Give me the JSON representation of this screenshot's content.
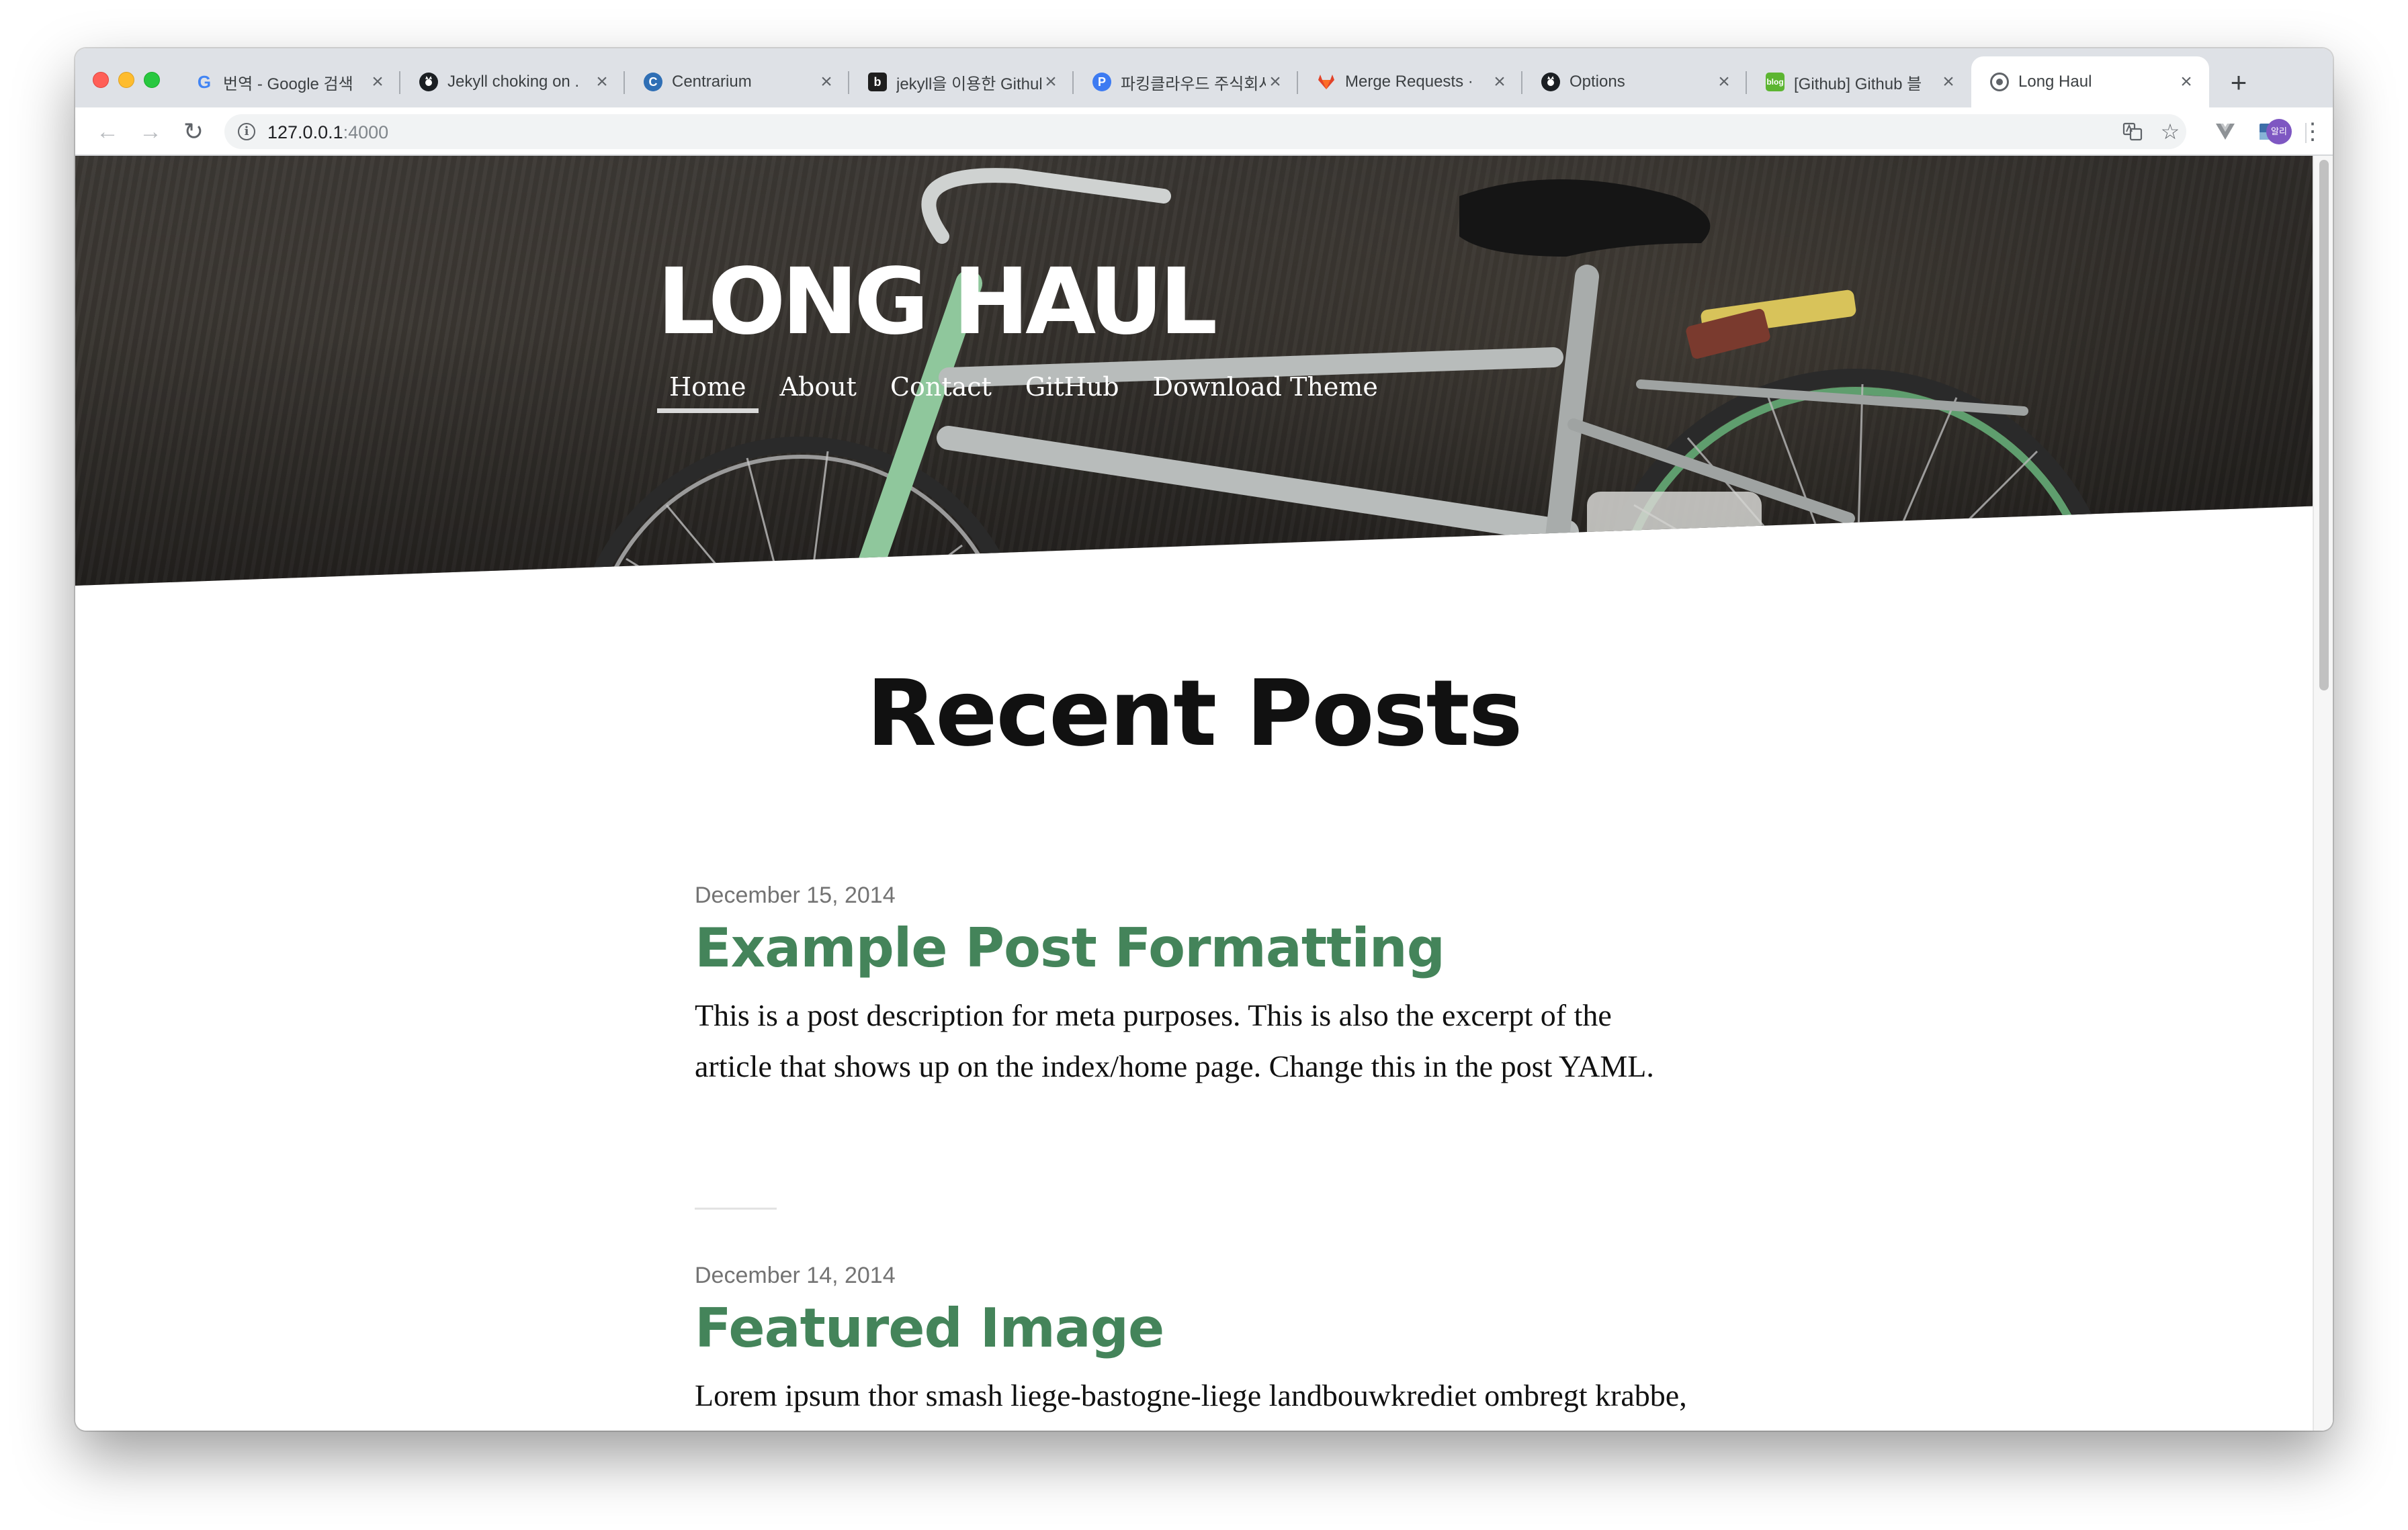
{
  "browser": {
    "tabs": [
      {
        "title": "번역 - Google 검색",
        "favicon": "google-icon",
        "favicon_color": "#ffffff",
        "active": false
      },
      {
        "title": "Jekyll choking on .",
        "favicon": "github-icon",
        "favicon_color": "#1b1f23",
        "active": false
      },
      {
        "title": "Centrarium",
        "favicon": "centrarium-icon",
        "favicon_color": "#2f6fb5",
        "active": false
      },
      {
        "title": "jekyll을 이용한 Github",
        "favicon": "blog-icon",
        "favicon_color": "#1e1e1e",
        "active": false
      },
      {
        "title": "파킹클라우드 주식회사",
        "favicon": "parkingcloud-icon",
        "favicon_color": "#3d7bf2",
        "active": false
      },
      {
        "title": "Merge Requests · ",
        "favicon": "gitlab-icon",
        "favicon_color": "#e24329",
        "active": false
      },
      {
        "title": "Options",
        "favicon": "github-icon",
        "favicon_color": "#1b1f23",
        "active": false
      },
      {
        "title": "[Github] Github 블",
        "favicon": "blog-green-icon",
        "favicon_color": "#5cb531",
        "active": false
      },
      {
        "title": "Long Haul",
        "favicon": "globe-icon",
        "favicon_color": "#5f6368",
        "active": true
      }
    ],
    "new_tab_label": "+",
    "url_host": "127.0.0.1",
    "url_port": ":4000",
    "avatar_text": "알리"
  },
  "site": {
    "title": "LONG HAUL",
    "nav": [
      {
        "label": "Home",
        "current": true
      },
      {
        "label": "About",
        "current": false
      },
      {
        "label": "Contact",
        "current": false
      },
      {
        "label": "GitHub",
        "current": false
      },
      {
        "label": "Download Theme",
        "current": false
      }
    ],
    "heading": "Recent Posts",
    "accent_color": "#44845a"
  },
  "posts": [
    {
      "date": "December 15, 2014",
      "title": "Example Post Formatting",
      "excerpt": "This is a post description for meta purposes. This is also the excerpt of the article that shows up on the index/home page. Change this in the post YAML."
    },
    {
      "date": "December 14, 2014",
      "title": "Featured Image",
      "excerpt": "Lorem ipsum thor smash liege-bastogne-liege landbouwkrediet ombregt krabbe, rouleur derby is for lovers honk giro gilbert bidon. Driedaagse de"
    }
  ]
}
